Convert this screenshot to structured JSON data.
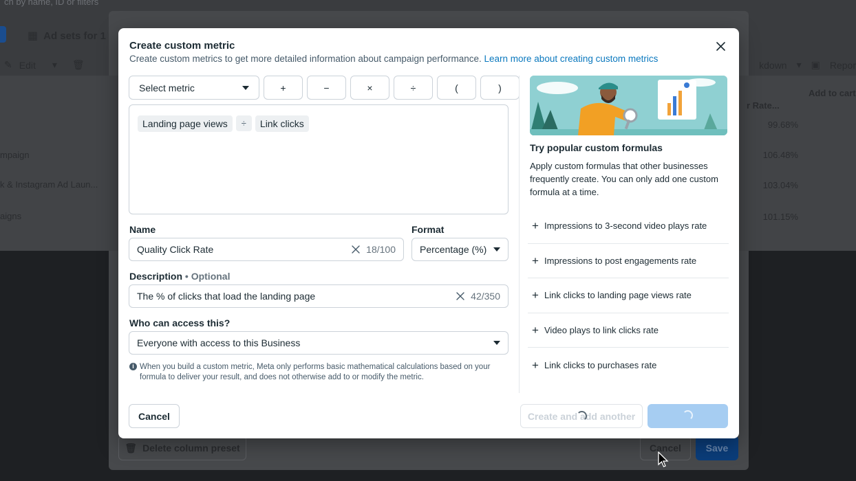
{
  "background": {
    "search_hint": "ch by name, ID or filters",
    "adsets_title": "Ad sets for 1",
    "edit_label": "Edit",
    "breakdown_label": "kdown",
    "reports_label": "Repor",
    "column_rate": "r Rate...",
    "column_add_to_cart": "Add to cart",
    "rows": [
      {
        "label": "",
        "value": "99.68%"
      },
      {
        "label": "mpaign",
        "value": "106.48%"
      },
      {
        "label": "k & Instagram Ad Laun...",
        "value": "103.04%"
      },
      {
        "label": "aigns",
        "value": "101.15%"
      }
    ],
    "delete_preset_label": "Delete column preset",
    "cancel_label": "Cancel",
    "save_label": "Save"
  },
  "dialog": {
    "title": "Create custom metric",
    "subtitle": "Create custom metrics to get more detailed information about campaign performance.",
    "learn_more": "Learn more about creating custom metrics",
    "select_metric": "Select metric",
    "operators": [
      "+",
      "−",
      "×",
      "÷",
      "(",
      ")"
    ],
    "formula": {
      "left": "Landing page views",
      "op": "÷",
      "right": "Link clicks"
    },
    "name_label": "Name",
    "name_value": "Quality Click Rate",
    "name_count": "18/100",
    "format_label": "Format",
    "format_value": "Percentage (%)",
    "description_label": "Description",
    "description_optional": "• Optional",
    "description_value": "The % of clicks that load the landing page",
    "description_count": "42/350",
    "access_label": "Who can access this?",
    "access_value": "Everyone with access to this Business",
    "note": "When you build a custom metric, Meta only performs basic mathematical calculations based on your formula to deliver your result, and does not otherwise add to or modify the metric.",
    "popular_title": "Try popular custom formulas",
    "popular_desc": "Apply custom formulas that other businesses frequently create. You can only add one custom formula at a time.",
    "popular_formulas": [
      "Impressions to 3-second video plays rate",
      "Impressions to post engagements rate",
      "Link clicks to landing page views rate",
      "Video plays to link clicks rate",
      "Link clicks to purchases rate"
    ],
    "cancel_label": "Cancel",
    "create_another_label": "Create and add another"
  },
  "colors": {
    "link": "#0a78be",
    "primary_disabled": "#a6cdf2",
    "border": "#cbd2d9"
  }
}
